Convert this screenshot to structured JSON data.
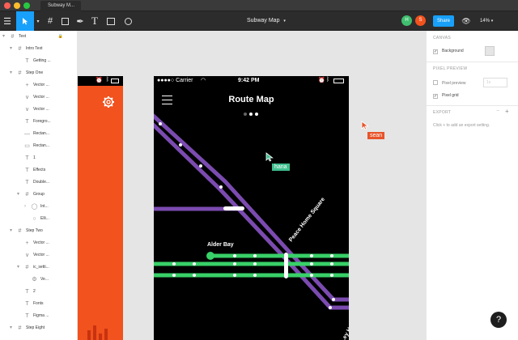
{
  "window": {
    "tab_title": "Subway M...",
    "traffic_lights": [
      "#fc5f57",
      "#fdbc2e",
      "#28c840"
    ]
  },
  "toolbar": {
    "doc_title": "Subway Map",
    "doc_caret": "▾",
    "zoom": "14%",
    "share_label": "Share",
    "avatars": [
      {
        "initial": "H",
        "color": "#3fbf6f"
      },
      {
        "initial": "S",
        "color": "#f2521d"
      }
    ],
    "menu_icon": "hamburger-icon",
    "tools": [
      "move-tool",
      "frame-tool",
      "shape-tool",
      "pen-tool",
      "text-tool",
      "image-tool",
      "comment-tool"
    ]
  },
  "layers": [
    {
      "name": "Text",
      "indent": 0,
      "icon": "frame",
      "expanded": true,
      "right": "🔒"
    },
    {
      "name": "Intro Text",
      "indent": 1,
      "icon": "frame",
      "expanded": true
    },
    {
      "name": "Getting ...",
      "indent": 2,
      "icon": "text"
    },
    {
      "name": "Step One",
      "indent": 1,
      "icon": "frame",
      "expanded": true
    },
    {
      "name": "Vector ...",
      "indent": 2,
      "icon": "plus"
    },
    {
      "name": "Vector ...",
      "indent": 2,
      "icon": "vector"
    },
    {
      "name": "Vector ...",
      "indent": 2,
      "icon": "vector"
    },
    {
      "name": "Foregro...",
      "indent": 2,
      "icon": "text"
    },
    {
      "name": "Rectan...",
      "indent": 2,
      "icon": "line"
    },
    {
      "name": "Rectan...",
      "indent": 2,
      "icon": "rect"
    },
    {
      "name": "1",
      "indent": 2,
      "icon": "text"
    },
    {
      "name": "Effects",
      "indent": 2,
      "icon": "text"
    },
    {
      "name": "Double...",
      "indent": 2,
      "icon": "text"
    },
    {
      "name": "Group",
      "indent": 2,
      "icon": "frame",
      "expanded": true
    },
    {
      "name": "Int...",
      "indent": 3,
      "icon": "ellipse",
      "collapsed": true
    },
    {
      "name": "Elli...",
      "indent": 3,
      "icon": "circle"
    },
    {
      "name": "Step Two",
      "indent": 1,
      "icon": "frame",
      "expanded": true
    },
    {
      "name": "Vector ...",
      "indent": 2,
      "icon": "plus"
    },
    {
      "name": "Vector ...",
      "indent": 2,
      "icon": "vector"
    },
    {
      "name": "ic_setti...",
      "indent": 2,
      "icon": "frame",
      "expanded": true
    },
    {
      "name": "Ve...",
      "indent": 3,
      "icon": "gear"
    },
    {
      "name": "2",
      "indent": 2,
      "icon": "text"
    },
    {
      "name": "Fonts",
      "indent": 2,
      "icon": "text"
    },
    {
      "name": "Figma ...",
      "indent": 2,
      "icon": "text"
    },
    {
      "name": "Step Eight",
      "indent": 1,
      "icon": "frame",
      "expanded": true
    }
  ],
  "phone": {
    "carrier": "●●●●○ Carrier",
    "time": "9:42 PM",
    "title": "Route Map",
    "station_alder": "Alder Bay",
    "station_peace": "Peace Home Square",
    "partial_label": "...ey Ha...",
    "line_colors": {
      "purple": "#7b4bb0",
      "green": "#38d068"
    }
  },
  "cursors": [
    {
      "name": "hana",
      "color": "#3fbf8f"
    },
    {
      "name": "sean",
      "color": "#e8532a"
    }
  ],
  "properties": {
    "canvas_title": "CANVAS",
    "background_label": "Background",
    "pixel_preview_title": "PIXEL PREVIEW",
    "pixel_preview_label": "Pixel preview",
    "pixel_preview_value": "1x",
    "pixel_grid_label": "Pixel grid",
    "export_title": "EXPORT",
    "export_hint": "Click + to add an export setting.",
    "export_minus": "−",
    "export_plus": "+"
  },
  "help_label": "?"
}
